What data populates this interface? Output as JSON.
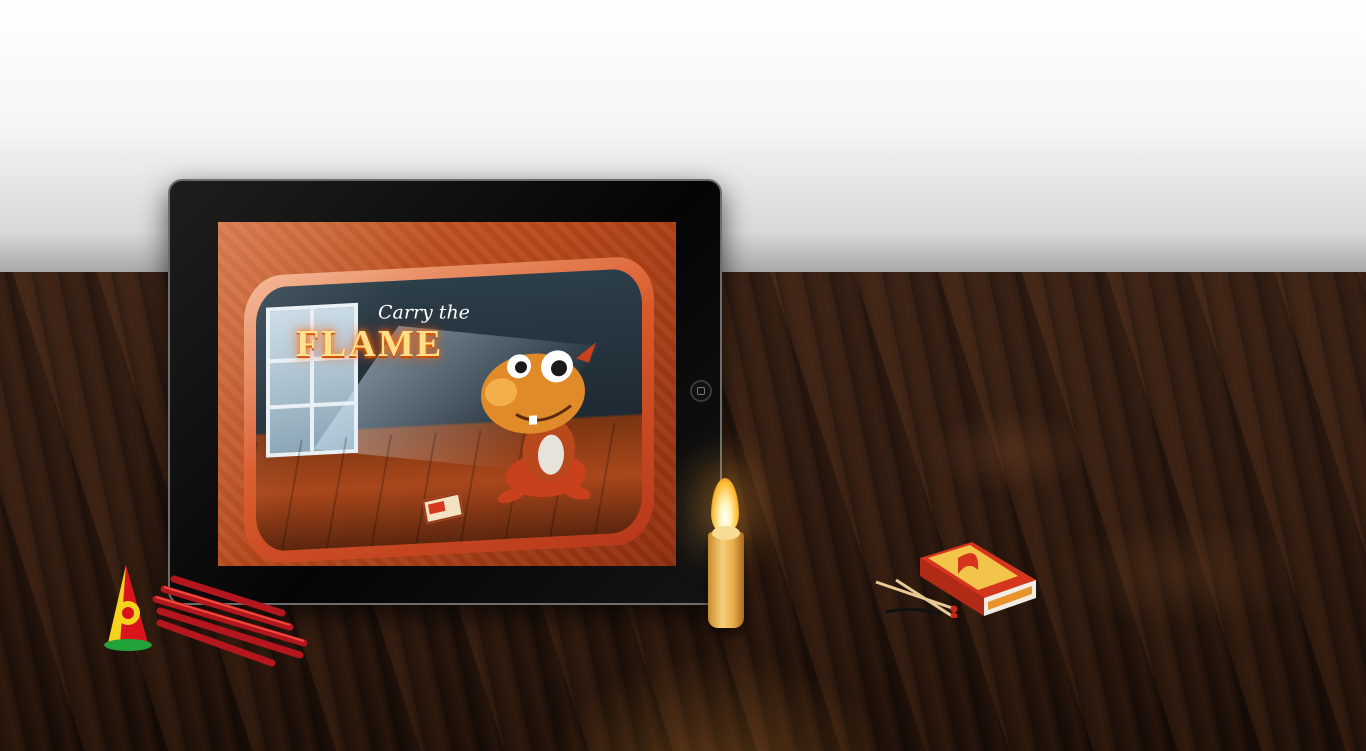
{
  "game_title": {
    "line1": "Carry the",
    "line2": "FLAME"
  },
  "colors": {
    "wall": "#f4f4f4",
    "table": "#2e1a10",
    "screen_bg": "#c4501f",
    "frame": "#d95a2a",
    "flame": "#ffb62e"
  },
  "icons": {
    "home_button": "home-button-icon",
    "candle": "candle-icon",
    "matchbox": "matchbox-icon",
    "firecracker": "firecracker-icon"
  }
}
